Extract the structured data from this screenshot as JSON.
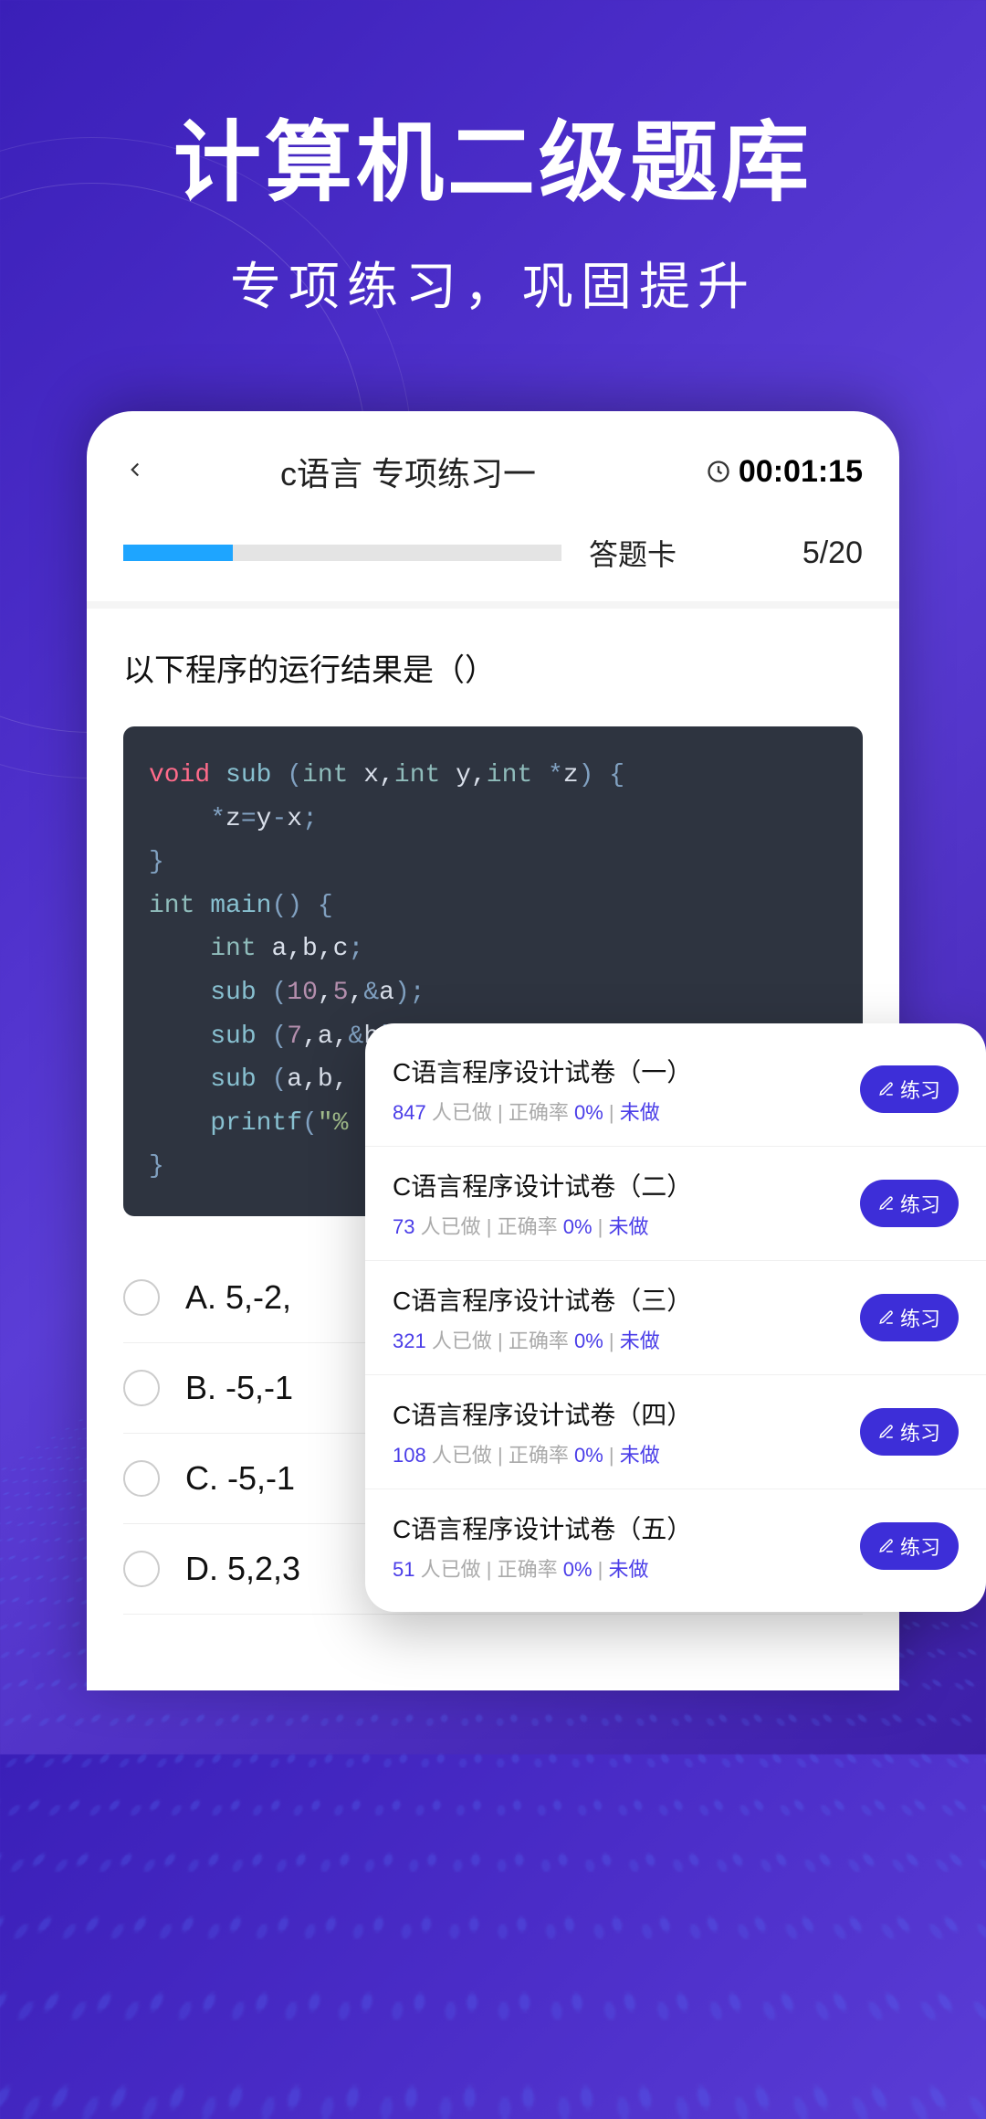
{
  "hero": {
    "title": "计算机二级题库",
    "subtitle": "专项练习，巩固提升"
  },
  "topbar": {
    "title": "c语言 专项练习一",
    "timer": "00:01:15"
  },
  "progress": {
    "answer_card_label": "答题卡",
    "count": "5/20",
    "percent": 25
  },
  "question": {
    "text": "以下程序的运行结果是（）"
  },
  "options": [
    {
      "label": "A. 5,-2,"
    },
    {
      "label": "B. -5,-1"
    },
    {
      "label": "C. -5,-1"
    },
    {
      "label": "D. 5,2,3"
    }
  ],
  "papers": [
    {
      "title": "C语言程序设计试卷（一）",
      "done_count": "847",
      "done_suffix": "人已做",
      "acc_label": "正确率",
      "acc": "0%",
      "status": "未做",
      "btn": "练习"
    },
    {
      "title": "C语言程序设计试卷（二）",
      "done_count": "73",
      "done_suffix": "人已做",
      "acc_label": "正确率",
      "acc": "0%",
      "status": "未做",
      "btn": "练习"
    },
    {
      "title": "C语言程序设计试卷（三）",
      "done_count": "321",
      "done_suffix": "人已做",
      "acc_label": "正确率",
      "acc": "0%",
      "status": "未做",
      "btn": "练习"
    },
    {
      "title": "C语言程序设计试卷（四）",
      "done_count": "108",
      "done_suffix": "人已做",
      "acc_label": "正确率",
      "acc": "0%",
      "status": "未做",
      "btn": "练习"
    },
    {
      "title": "C语言程序设计试卷（五）",
      "done_count": "51",
      "done_suffix": "人已做",
      "acc_label": "正确率",
      "acc": "0%",
      "status": "未做",
      "btn": "练习"
    }
  ]
}
